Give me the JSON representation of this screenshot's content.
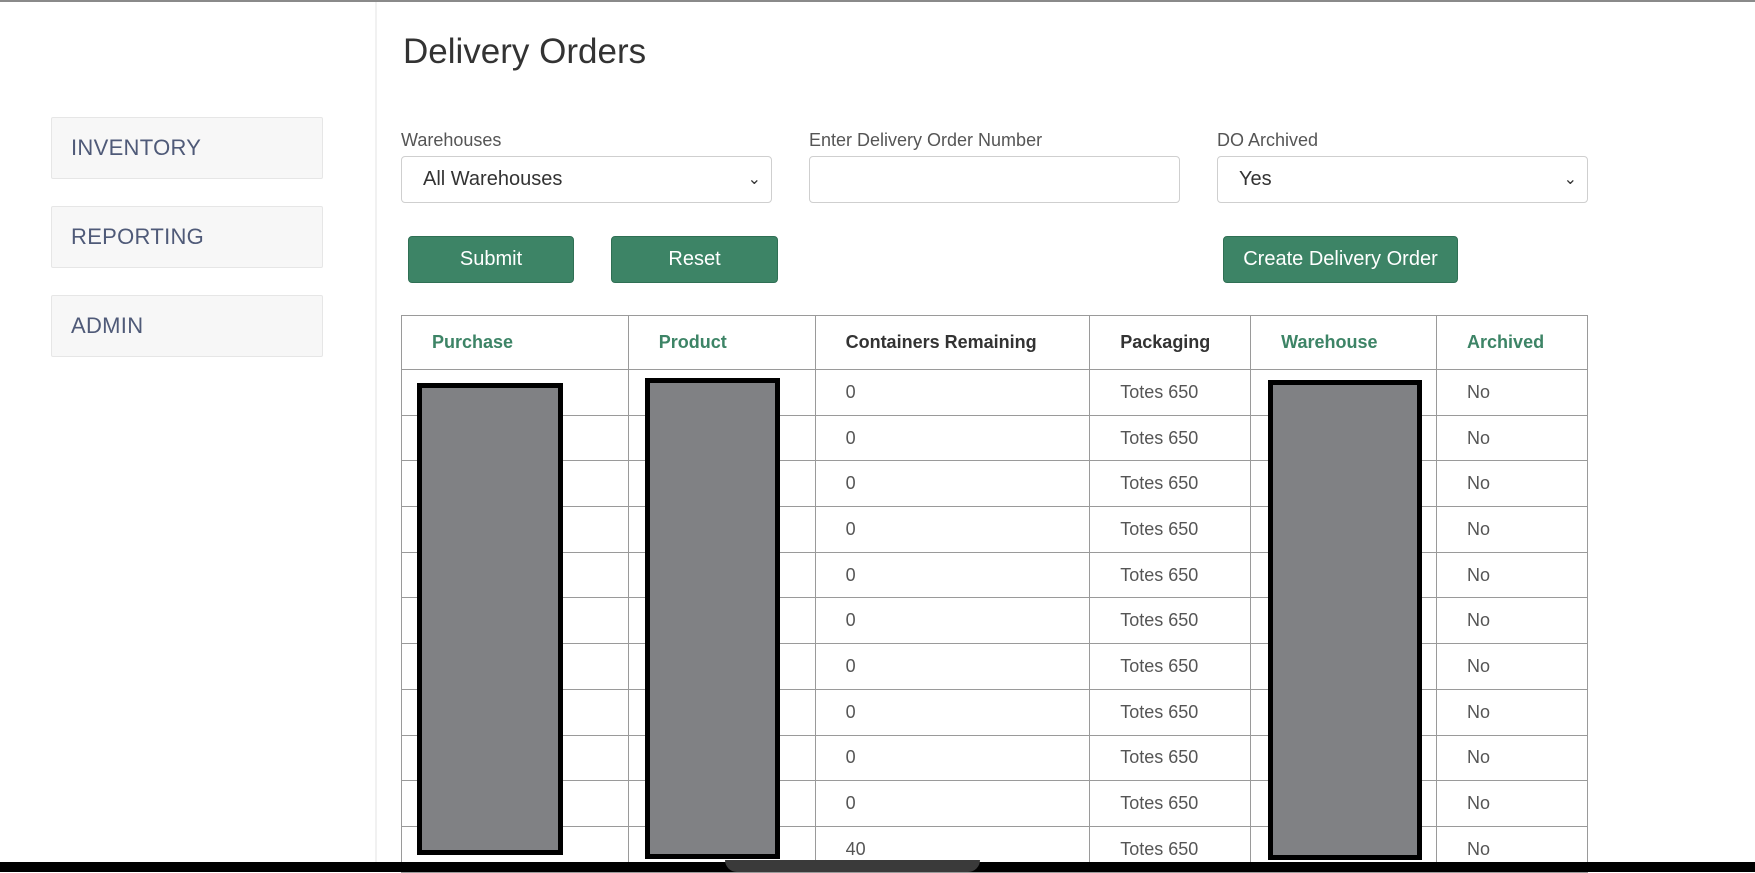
{
  "sidebar": {
    "items": [
      {
        "label": "INVENTORY"
      },
      {
        "label": "REPORTING"
      },
      {
        "label": "ADMIN"
      }
    ]
  },
  "page": {
    "title": "Delivery Orders"
  },
  "filters": {
    "warehouses": {
      "label": "Warehouses",
      "value": "All Warehouses"
    },
    "do_number": {
      "label": "Enter Delivery Order Number",
      "value": "",
      "placeholder": ""
    },
    "do_archived": {
      "label": "DO Archived",
      "value": "Yes"
    }
  },
  "buttons": {
    "submit": "Submit",
    "reset": "Reset",
    "create": "Create Delivery Order"
  },
  "colors": {
    "accent": "#3d8466",
    "sidebar_text": "#4f5a78"
  },
  "table": {
    "headers": [
      "Purchase",
      "Product",
      "Containers Remaining",
      "Packaging",
      "Warehouse",
      "Archived"
    ],
    "sortable": [
      true,
      true,
      false,
      false,
      true,
      true
    ],
    "rows": [
      {
        "purchase": "",
        "product": "",
        "containers": "0",
        "packaging": "Totes 650",
        "warehouse": "",
        "archived": "No"
      },
      {
        "purchase": "",
        "product": "",
        "containers": "0",
        "packaging": "Totes 650",
        "warehouse": "",
        "archived": "No"
      },
      {
        "purchase": "",
        "product": "",
        "containers": "0",
        "packaging": "Totes 650",
        "warehouse": "",
        "archived": "No"
      },
      {
        "purchase": "",
        "product": "",
        "containers": "0",
        "packaging": "Totes 650",
        "warehouse": "",
        "archived": "No"
      },
      {
        "purchase": "",
        "product": "",
        "containers": "0",
        "packaging": "Totes 650",
        "warehouse": "",
        "archived": "No"
      },
      {
        "purchase": "",
        "product": "",
        "containers": "0",
        "packaging": "Totes 650",
        "warehouse": "",
        "archived": "No"
      },
      {
        "purchase": "",
        "product": "",
        "containers": "0",
        "packaging": "Totes 650",
        "warehouse": "",
        "archived": "No"
      },
      {
        "purchase": "",
        "product": "",
        "containers": "0",
        "packaging": "Totes 650",
        "warehouse": "",
        "archived": "No"
      },
      {
        "purchase": "",
        "product": "",
        "containers": "0",
        "packaging": "Totes 650",
        "warehouse": "",
        "archived": "No"
      },
      {
        "purchase": "",
        "product": "",
        "containers": "0",
        "packaging": "Totes 650",
        "warehouse": "",
        "archived": "No"
      },
      {
        "purchase": "",
        "product": "",
        "containers": "40",
        "packaging": "Totes 650",
        "warehouse": "",
        "archived": "No"
      }
    ]
  }
}
